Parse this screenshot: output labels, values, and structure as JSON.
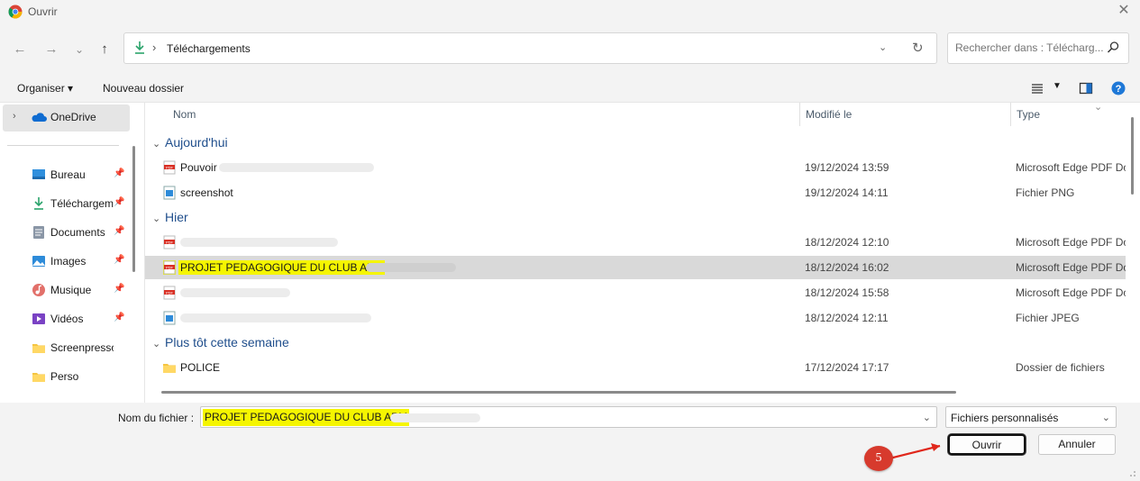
{
  "window": {
    "title": "Ouvrir",
    "close_label": "✕"
  },
  "nav": {
    "back": "←",
    "forward": "→",
    "recent": "⌄",
    "up": "↑",
    "path_separator": "›",
    "path": "Téléchargements",
    "search_placeholder": "Rechercher dans : Télécharg..."
  },
  "toolbar": {
    "organize": "Organiser ▾",
    "new_folder": "Nouveau dossier"
  },
  "sidebar": {
    "onedrive": "OneDrive",
    "items": [
      {
        "label": "Bureau",
        "icon": "desktop-icon",
        "pinned": true
      },
      {
        "label": "Téléchargem",
        "icon": "download-icon",
        "pinned": true
      },
      {
        "label": "Documents",
        "icon": "documents-icon",
        "pinned": true
      },
      {
        "label": "Images",
        "icon": "images-icon",
        "pinned": true
      },
      {
        "label": "Musique",
        "icon": "music-icon",
        "pinned": true
      },
      {
        "label": "Vidéos",
        "icon": "videos-icon",
        "pinned": true
      },
      {
        "label": "Screenpresso",
        "icon": "folder-icon",
        "pinned": false
      },
      {
        "label": "Perso",
        "icon": "folder-icon",
        "pinned": false
      }
    ]
  },
  "columns": {
    "name": "Nom",
    "modified": "Modifié le",
    "type": "Type"
  },
  "groups": {
    "today": "Aujourd'hui",
    "yesterday": "Hier",
    "earlier": "Plus tôt cette semaine"
  },
  "files": {
    "today": [
      {
        "name": "Pouvoir ",
        "date": "19/12/2024 13:59",
        "type": "Microsoft Edge PDF Document",
        "icon": "pdf-icon"
      },
      {
        "name": "screenshot",
        "date": "19/12/2024 14:11",
        "type": "Fichier PNG",
        "icon": "image-file-icon"
      }
    ],
    "yesterday": [
      {
        "name": "",
        "date": "18/12/2024 12:10",
        "type": "Microsoft Edge PDF Document",
        "icon": "pdf-icon"
      },
      {
        "name": "PROJET PEDAGOGIQUE DU CLUB APM",
        "date": "18/12/2024 16:02",
        "type": "Microsoft Edge PDF Document",
        "icon": "pdf-icon",
        "selected": true
      },
      {
        "name": "",
        "date": "18/12/2024 15:58",
        "type": "Microsoft Edge PDF Document",
        "icon": "pdf-icon"
      },
      {
        "name": "",
        "date": "18/12/2024 12:11",
        "type": "Fichier JPEG",
        "icon": "image-file-icon"
      }
    ],
    "earlier": [
      {
        "name": "POLICE",
        "date": "17/12/2024 17:17",
        "type": "Dossier de fichiers",
        "icon": "folder-icon"
      }
    ]
  },
  "footer": {
    "filename_label": "Nom du fichier :",
    "filename_value": "PROJET PEDAGOGIQUE DU CLUB APM",
    "filetype": "Fichiers personnalisés",
    "open_button": "Ouvrir",
    "cancel_button": "Annuler",
    "step_number": "5"
  },
  "colors": {
    "highlight": "#f5f500",
    "badge": "#d73a2d",
    "group_text": "#1f4e8c",
    "selected_row": "#d9d9d9"
  }
}
